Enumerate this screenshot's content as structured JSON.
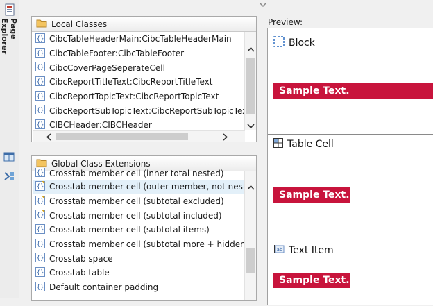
{
  "explorer": {
    "tab_label": "Page Explorer"
  },
  "local_classes": {
    "title": "Local Classes",
    "items": [
      "CibcTableHeaderMain:CibcTableHeaderMain",
      "CibcTableFooter:CibcTableFooter",
      "CibcCoverPageSeperateCell",
      "CibcReportTitleText:CibcReportTitleText",
      "CibcReportTopicText:CibcReportTopicText",
      "CibcReportSubTopicText:CibcReportSubTopicText",
      "CIBCHeader:CIBCHeader"
    ]
  },
  "global_classes": {
    "title": "Global Class Extensions",
    "items": [
      "Crosstab member cell (inner total nested)",
      "Crosstab member cell (outer member, not nested)",
      "Crosstab member cell (subtotal excluded)",
      "Crosstab member cell (subtotal included)",
      "Crosstab member cell (subtotal items)",
      "Crosstab member cell (subtotal more + hidden)",
      "Crosstab space",
      "Crosstab table",
      "Default container padding"
    ],
    "selected_index": 1
  },
  "preview": {
    "label": "Preview:",
    "sections": [
      {
        "title": "Block",
        "sample": "Sample Text."
      },
      {
        "title": "Table Cell",
        "sample": "Sample Text."
      },
      {
        "title": "Text Item",
        "sample": "Sample Text."
      }
    ]
  },
  "colors": {
    "sample_bg": "#c8143c",
    "selection": "#e3f0f9"
  }
}
